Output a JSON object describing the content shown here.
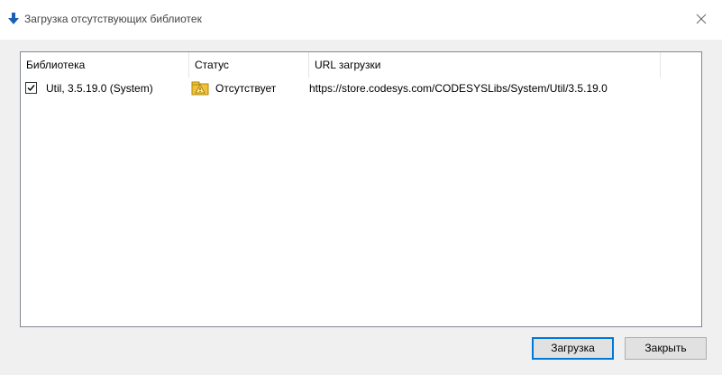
{
  "window": {
    "title": "Загрузка отсутствующих библиотек"
  },
  "table": {
    "columns": [
      "Библиотека",
      "Статус",
      "URL загрузки"
    ],
    "rows": [
      {
        "checked": true,
        "library": "Util, 3.5.19.0 (System)",
        "status": "Отсутствует",
        "status_icon": "warning-icon",
        "url": "https://store.codesys.com/CODESYSLibs/System/Util/3.5.19.0"
      }
    ]
  },
  "buttons": {
    "download_label": "Загрузка",
    "close_label": "Закрыть"
  },
  "colors": {
    "accent": "#0078d7",
    "warning": "#f5c400",
    "title_icon": "#1a5fb4"
  }
}
